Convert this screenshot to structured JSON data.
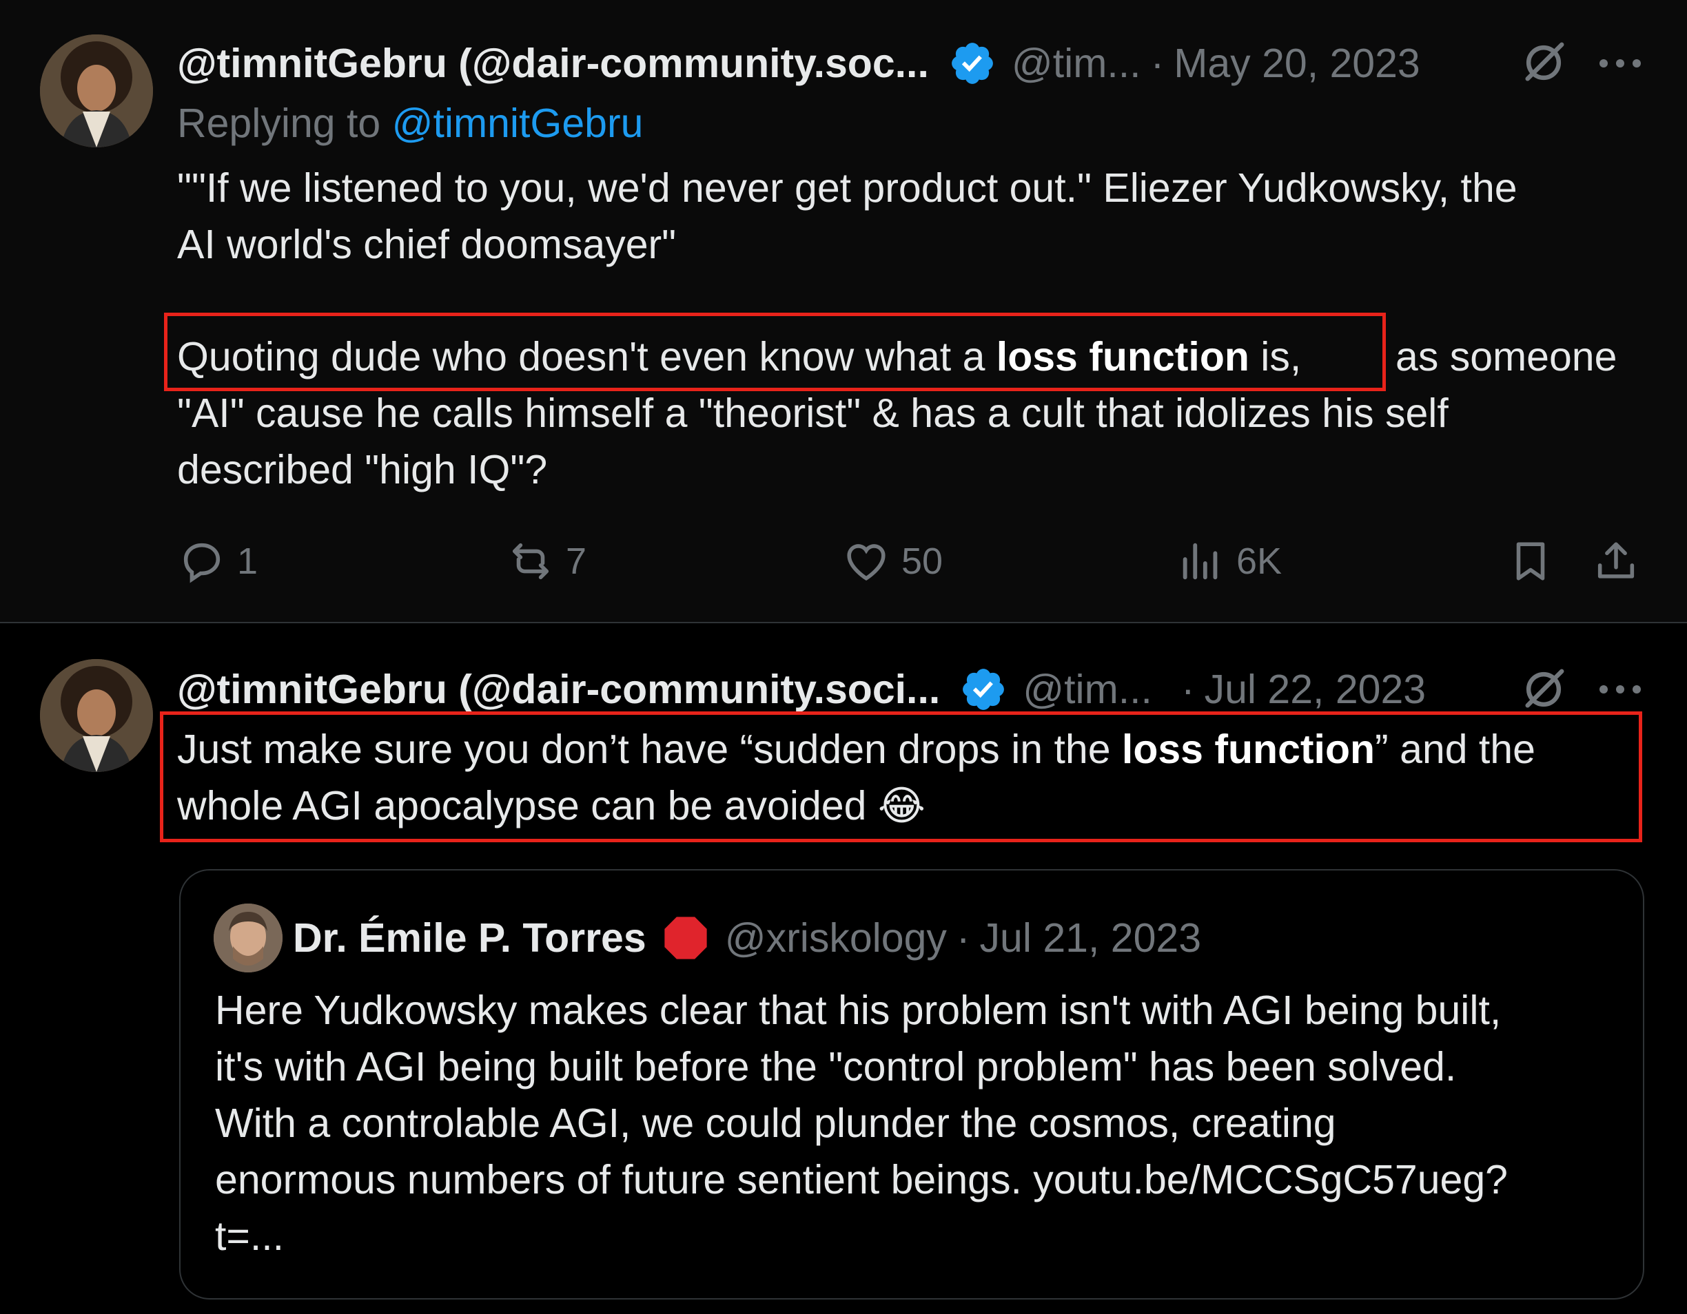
{
  "tweet1": {
    "author_name": "@timnitGebru (@dair-community.soc...",
    "handle": "@tim...",
    "separator": "·",
    "date": "May 20, 2023",
    "replying_prefix": "Replying to ",
    "replying_to": "@timnitGebru",
    "line1": "\"\"If we listened to you, we'd never get product out.\" Eliezer Yudkowsky, the",
    "line2": "AI world's chief doomsayer\"",
    "line3_a": "Quoting dude who doesn't even know what a ",
    "line3_bold": "loss function",
    "line3_b": " is,",
    "line3_c": "as someone",
    "line4": "\"AI\" cause he calls himself a \"theorist\" & has a cult that idolizes his self",
    "line5": "described \"high IQ\"?",
    "stats": {
      "replies": "1",
      "reposts": "7",
      "likes": "50",
      "views": "6K"
    }
  },
  "tweet2": {
    "author_name": "@timnitGebru (@dair-community.soci...",
    "handle": "@tim...",
    "separator": "·",
    "date": "Jul 22, 2023",
    "line1_a": "Just make sure you don’t have “sudden drops in the ",
    "line1_bold": "loss function",
    "line1_b": "” and the",
    "line2": "whole AGI apocalypse can be avoided",
    "emoji": "😂"
  },
  "quote": {
    "author_name": "Dr. Émile P. Torres",
    "handle": "@xriskology",
    "separator": "·",
    "date": "Jul 21, 2023",
    "lines": [
      "Here Yudkowsky makes clear that his problem isn't with AGI being built,",
      "it's with AGI being built before the \"control problem\" has been solved.",
      "With a controlable AGI, we could plunder the cosmos, creating",
      "enormous numbers of future sentient beings. youtu.be/MCCSgC57ueg?",
      "t=..."
    ]
  },
  "colors": {
    "background": "#000000",
    "text": "#e7e9ea",
    "muted": "#71767b",
    "link": "#1d9bf0",
    "verified": "#1d9bf0",
    "highlight_box": "#e8231a",
    "stop_sign": "#e0242c"
  },
  "icons": [
    "verified-badge-icon",
    "grok-icon",
    "more-icon",
    "reply-icon",
    "repost-icon",
    "like-icon",
    "views-icon",
    "bookmark-icon",
    "share-icon",
    "stop-sign-icon"
  ]
}
